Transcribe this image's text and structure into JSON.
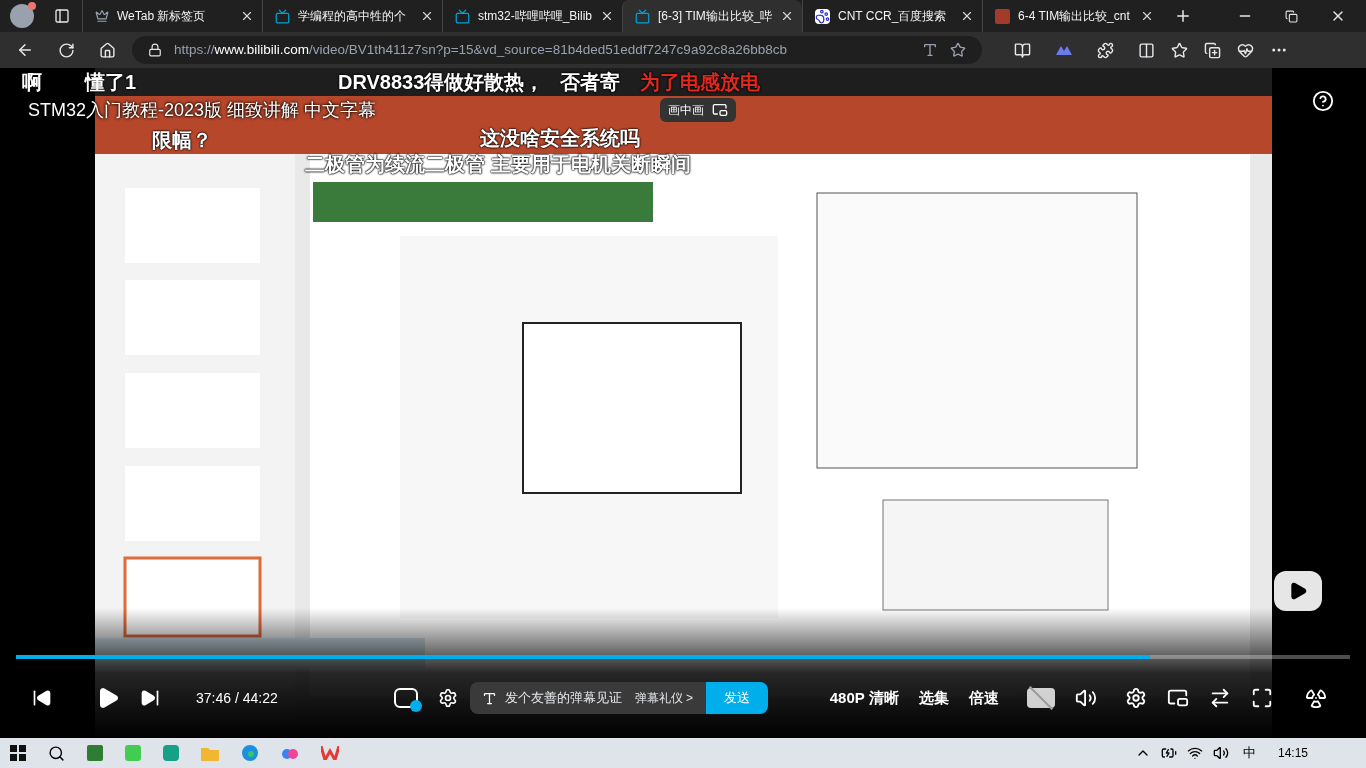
{
  "tabs": [
    {
      "title": "WeTab 新标签页",
      "kind": "crown",
      "selected": false
    },
    {
      "title": "学编程的高中牲的个",
      "kind": "tv",
      "selected": false
    },
    {
      "title": "stm32-哔哩哔哩_Bilib",
      "kind": "tv",
      "selected": false
    },
    {
      "title": "[6-3] TIM输出比较_哔",
      "kind": "tv",
      "selected": true
    },
    {
      "title": "CNT CCR_百度搜索",
      "kind": "paw",
      "selected": false
    },
    {
      "title": "6-4 TIM输出比较_cnt",
      "kind": "letter",
      "selected": false
    }
  ],
  "address_bar": {
    "url": "https://**www.bilibili.com**/video/BV1th411z7sn?p=15&vd_source=81b4ded51eddf7247c9a92c8a26bb8cb"
  },
  "player": {
    "title": "STM32入门教程-2023版 细致讲解 中文字幕",
    "pip_label": "画中画",
    "danmaku": [
      {
        "text": "啊",
        "color": "#ffffff"
      },
      {
        "text": "懂了1",
        "color": "#ffffff"
      },
      {
        "text": "限幅？",
        "color": "#ffffff"
      },
      {
        "text": "DRV8833得做好散热，",
        "color": "#ffffff"
      },
      {
        "text": "否者寄",
        "color": "#ffffff"
      },
      {
        "text": "为了电感放电",
        "color": "#e0281e"
      },
      {
        "text": "这没啥安全系统吗",
        "color": "#ffffff"
      },
      {
        "text": "二极管为续流二极管 主要用于电机关断瞬间",
        "color": "#ffffff"
      }
    ],
    "progress": {
      "level": 0.85
    },
    "time": "37:46 / 44:22",
    "danmaku_on": true,
    "subtitles_on": false,
    "danmaku_input": {
      "placeholder": "发个友善的弹幕见证"
    },
    "etiquette_link": "弹幕礼仪 >",
    "send_button": "发送",
    "quality": "480P 清晰",
    "episodes": "选集",
    "speed": "倍速"
  },
  "taskbar": {
    "ime": "中",
    "clock": "14:15"
  }
}
